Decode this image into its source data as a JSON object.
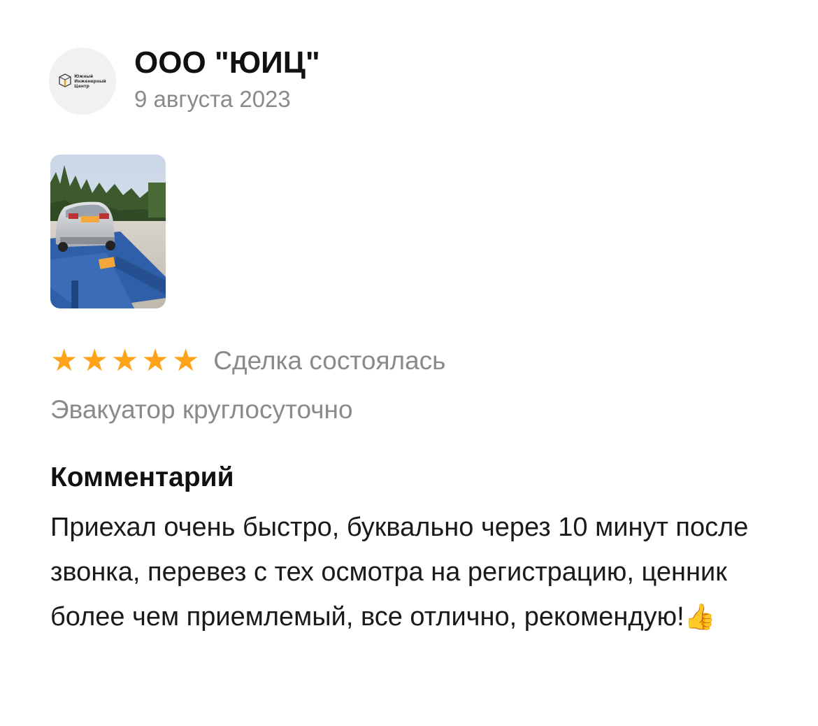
{
  "header": {
    "avatar": {
      "icon": "company-logo-icon",
      "logo_lines": [
        "Южный",
        "Инженерный",
        "Центр"
      ]
    },
    "author_name": "ООО \"ЮИЦ\"",
    "date": "9 августа 2023"
  },
  "photo": {
    "icon": "review-photo"
  },
  "rating": {
    "stars": 5,
    "max_stars": 5,
    "star_glyph": "★",
    "star_color": "#ffa31a",
    "status": "Сделка состоялась"
  },
  "service": "Эвакуатор круглосуточно",
  "comment": {
    "heading": "Комментарий",
    "text": "Приехал очень быстро, буквально через 10 минут после звонка, перевез с тех осмотра на регистрацию, ценник более чем приемлемый, все отлично, рекомендую!",
    "emoji": "👍",
    "emoji_icon": "thumbs-up-icon"
  }
}
